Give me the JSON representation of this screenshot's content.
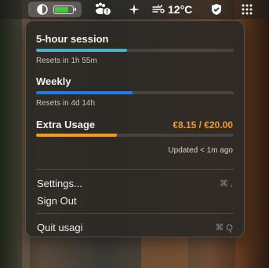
{
  "menubar": {
    "icons": [
      "usage-ring-icon",
      "battery-icon",
      "paw-alert-icon",
      "sparkle-icon",
      "wind-icon",
      "shield-icon",
      "control-center-icon"
    ],
    "battery_level": 0.8,
    "battery_color": "#3ccd3c",
    "temperature": "12°C"
  },
  "popup": {
    "session": {
      "title": "5-hour session",
      "reset": "Resets in 1h 55m",
      "progress": 0.46,
      "color": "#4ab0cc"
    },
    "weekly": {
      "title": "Weekly",
      "reset": "Resets in 4d 14h",
      "progress": 0.49,
      "color": "#1f7bf2"
    },
    "extra": {
      "title": "Extra Usage",
      "amount": "€8.15 / €20.00",
      "progress": 0.41,
      "color": "#f79b1e"
    },
    "updated": "Updated < 1m ago",
    "menu": {
      "settings": {
        "label": "Settings...",
        "shortcut": "⌘ ,"
      },
      "sign_out": {
        "label": "Sign Out"
      },
      "quit": {
        "label": "Quit usagi",
        "shortcut": "⌘ Q"
      }
    }
  }
}
